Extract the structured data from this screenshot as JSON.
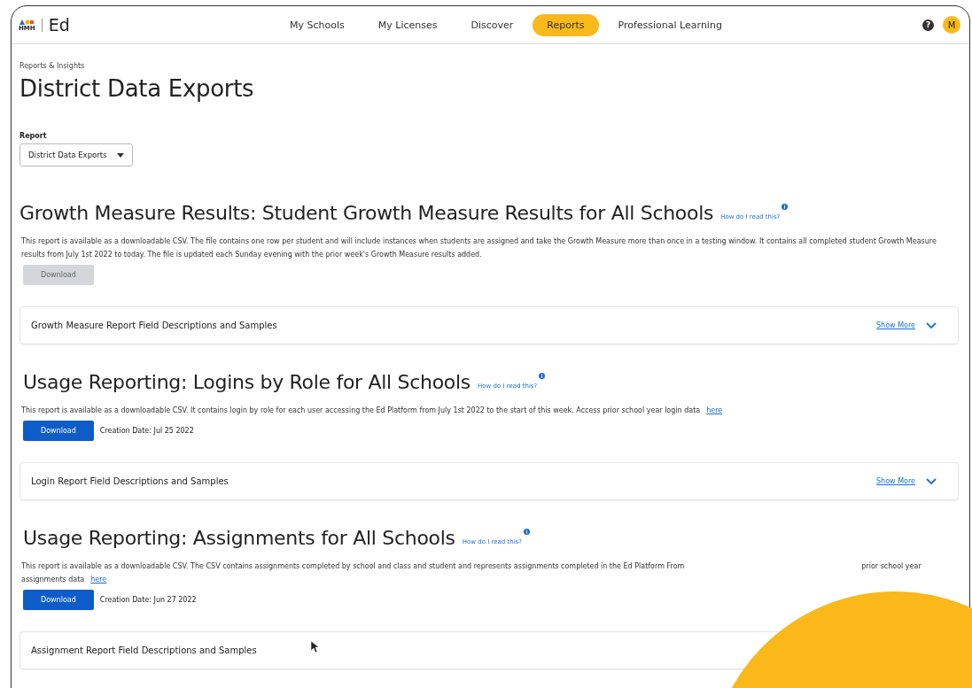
{
  "header": {
    "logo_small": "HMH",
    "logo": "Ed",
    "nav": [
      {
        "label": "My Schools",
        "selected": false
      },
      {
        "label": "My Licenses",
        "selected": false
      },
      {
        "label": "Discover",
        "selected": false
      },
      {
        "label": "Reports",
        "selected": true
      },
      {
        "label": "Professional Learning",
        "selected": false
      }
    ],
    "help": "?",
    "avatar": "M"
  },
  "breadcrumb": "Reports & Insights",
  "title": "District Data Exports",
  "report_select": {
    "label": "Report",
    "value": "District Data Exports"
  },
  "sections": [
    {
      "title": "Growth Measure Results: Student Growth Measure Results for All Schools",
      "help_link": "How do I read this?",
      "description": [
        "This report is available as a downloadable CSV. The file contains one row per student and will include instances when students are assigned and take the Growth Measure more than once in a testing window. It contains all completed student Growth Measure results from July 1st 2022 to today. The file is updated each Sunday evening with the prior week's Growth Measure results added."
      ],
      "download": {
        "label": "Download",
        "disabled": true
      },
      "accordion": {
        "title": "Growth Measure Report Field Descriptions and Samples",
        "show_more": "Show More"
      }
    },
    {
      "title": "Usage Reporting: Logins by Role for All Schools",
      "help_link": "How do I read this?",
      "description": [
        "This report is available as a downloadable CSV. It contains login by role for each user accessing the Ed Platform from July 1st 2022 to the start of this week. Access prior school year login data"
      ],
      "link": "here",
      "download": {
        "label": "Download",
        "disabled": false
      },
      "creation_date": "Creation Date: Jul 25 2022",
      "accordion": {
        "title": "Login Report Field Descriptions and Samples",
        "show_more": "Show More"
      }
    },
    {
      "title": "Usage Reporting: Assignments for All Schools",
      "help_link": "How do I read this?",
      "description": [
        "This report is available as a downloadable CSV. The CSV contains assignments completed by school and class and student and represents assignments completed in the Ed Platform From",
        "prior school year assignments data"
      ],
      "link": "here",
      "download": {
        "label": "Download",
        "disabled": false
      },
      "creation_date": "Creation Date: Jun 27 2022",
      "accordion": {
        "title": "Assignment Report Field Descriptions and Samples"
      }
    }
  ]
}
